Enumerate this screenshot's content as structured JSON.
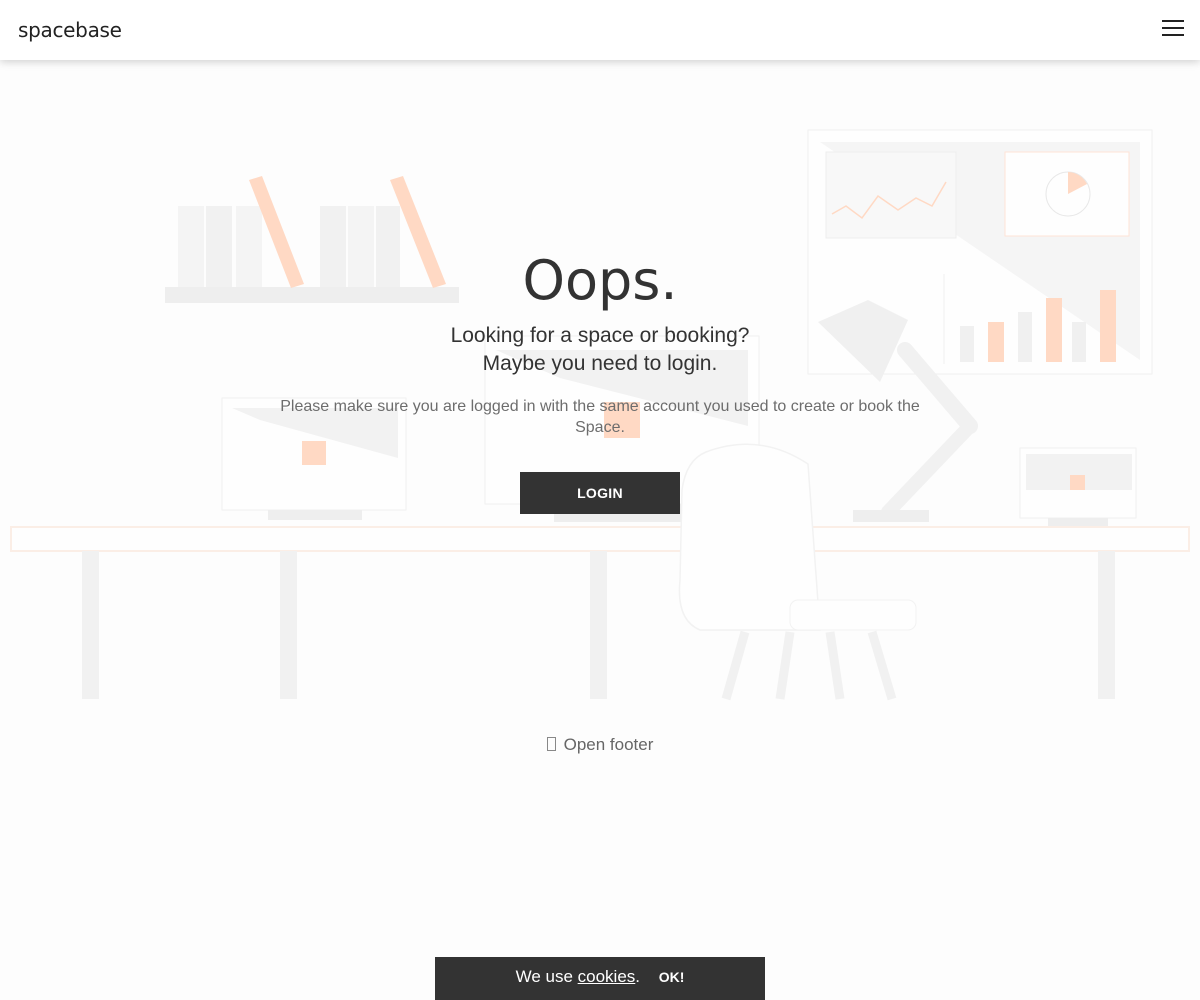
{
  "header": {
    "logo_text": "spacebase",
    "menu_icon": "hamburger-icon"
  },
  "main": {
    "title": "Oops.",
    "subtitle_line1": "Looking for a space or booking?",
    "subtitle_line2": "Maybe you need to login.",
    "note": "Please make sure you are logged in with the same account you used to create or book the Space.",
    "login_label": "LOGIN"
  },
  "footer_toggle": {
    "icon": "mobile-icon",
    "label": "Open footer"
  },
  "cookie_banner": {
    "prefix": "We use ",
    "link_label": "cookies",
    "suffix": ".",
    "ok_label": "OK!"
  },
  "colors": {
    "accent": "#ffcdb3",
    "dark": "#333333",
    "illustration_gray": "#eeeeee"
  }
}
